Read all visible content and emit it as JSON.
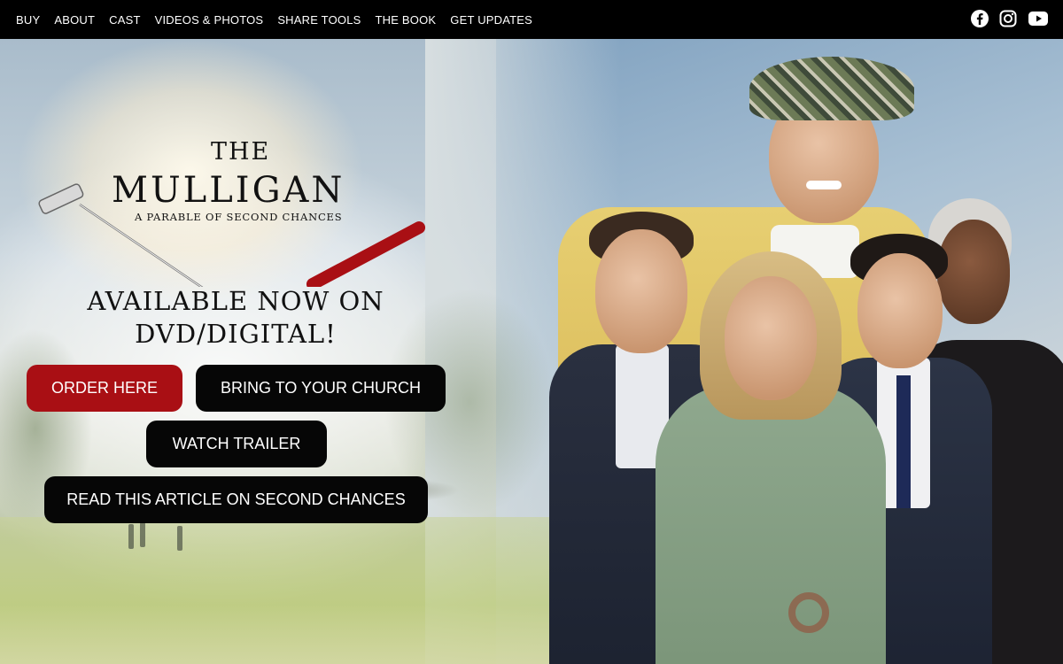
{
  "nav": {
    "links": [
      "BUY",
      "ABOUT",
      "CAST",
      "VIDEOS & PHOTOS",
      "SHARE TOOLS",
      "THE BOOK",
      "GET UPDATES"
    ],
    "social_icons": [
      "facebook-icon",
      "instagram-icon",
      "youtube-icon"
    ]
  },
  "hero": {
    "title_the": "THE",
    "title_main": "MULLIGAN",
    "title_sub": "A PARABLE OF SECOND CHANCES",
    "available_line1": "AVAILABLE NOW ON",
    "available_line2": "DVD/DIGITAL!",
    "buttons": {
      "order": "ORDER HERE",
      "church": "BRING TO YOUR CHURCH",
      "trailer": "WATCH TRAILER",
      "article": "READ THIS ARTICLE ON SECOND CHANCES"
    }
  },
  "colors": {
    "nav_bg": "#000000",
    "accent_red": "#a90f14",
    "button_black": "#060606",
    "title_text": "#111111"
  }
}
